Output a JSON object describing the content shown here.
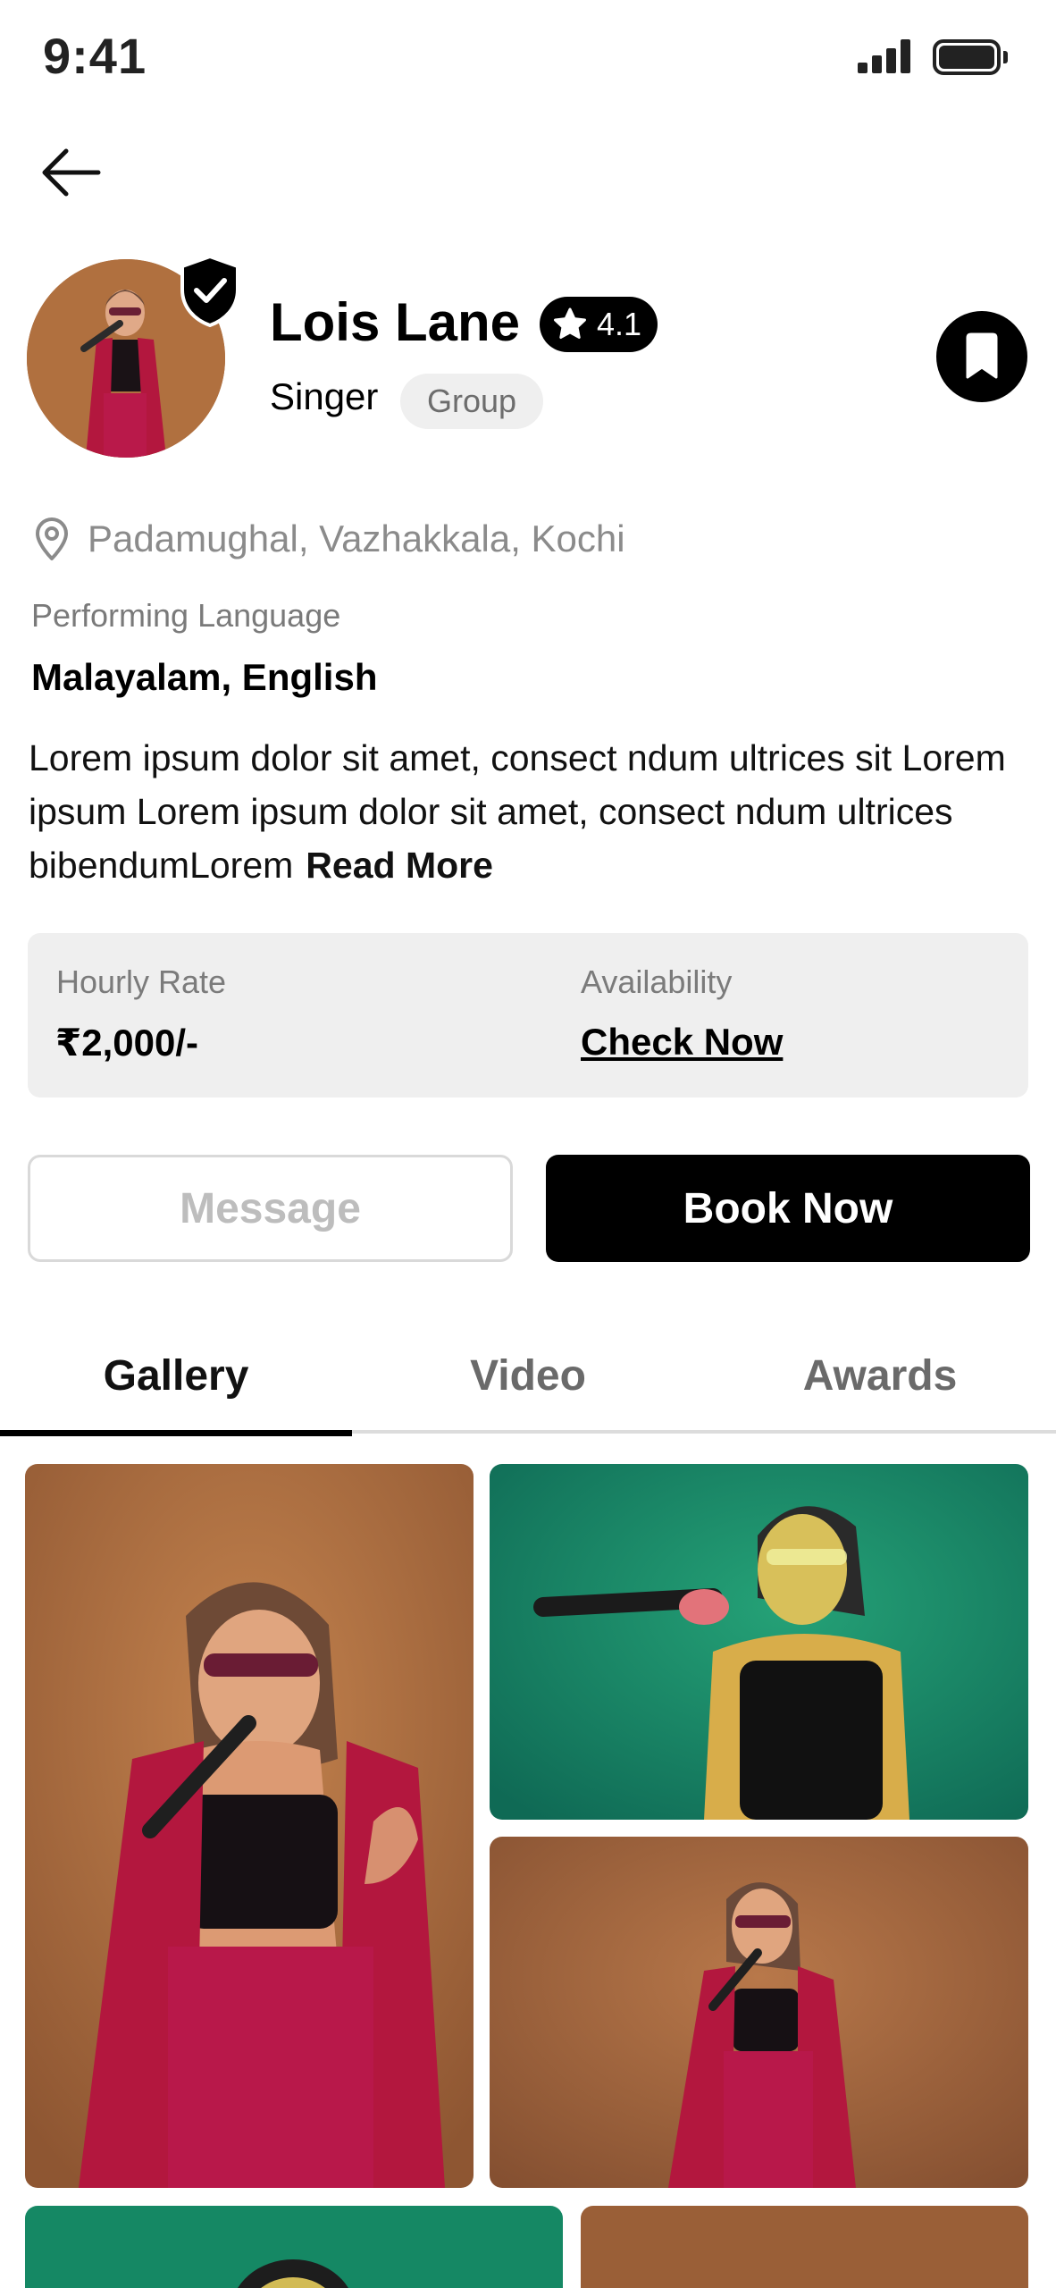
{
  "status_bar": {
    "time": "9:41"
  },
  "profile": {
    "name": "Lois Lane",
    "rating": "4.1",
    "role": "Singer",
    "tag": "Group",
    "location": "Padamughal, Vazhakkala, Kochi",
    "language_label": "Performing Language",
    "languages": "Malayalam, English",
    "description": "Lorem ipsum dolor sit amet, consect ndum ultrices sit Lorem ipsum Lorem ipsum dolor sit amet, consect ndum ultrices bibendumLorem",
    "read_more": "Read More"
  },
  "info": {
    "rate_label": "Hourly Rate",
    "rate_value": "₹2,000/-",
    "availability_label": "Availability",
    "availability_link": "Check Now"
  },
  "actions": {
    "message": "Message",
    "book": "Book Now"
  },
  "tabs": [
    {
      "label": "Gallery",
      "active": true
    },
    {
      "label": "Video",
      "active": false
    },
    {
      "label": "Awards",
      "active": false
    }
  ],
  "icons": {
    "back": "arrow-left-icon",
    "verified": "shield-check-icon",
    "rating": "star-icon",
    "bookmark": "bookmark-icon",
    "location": "map-pin-icon"
  },
  "colors": {
    "accent": "#000000",
    "chip_bg": "#efefef",
    "card_bg": "#efefef",
    "photo_warm": "#a4663a",
    "photo_green": "#1e8c6c",
    "muted_text": "#7b7b7b"
  }
}
